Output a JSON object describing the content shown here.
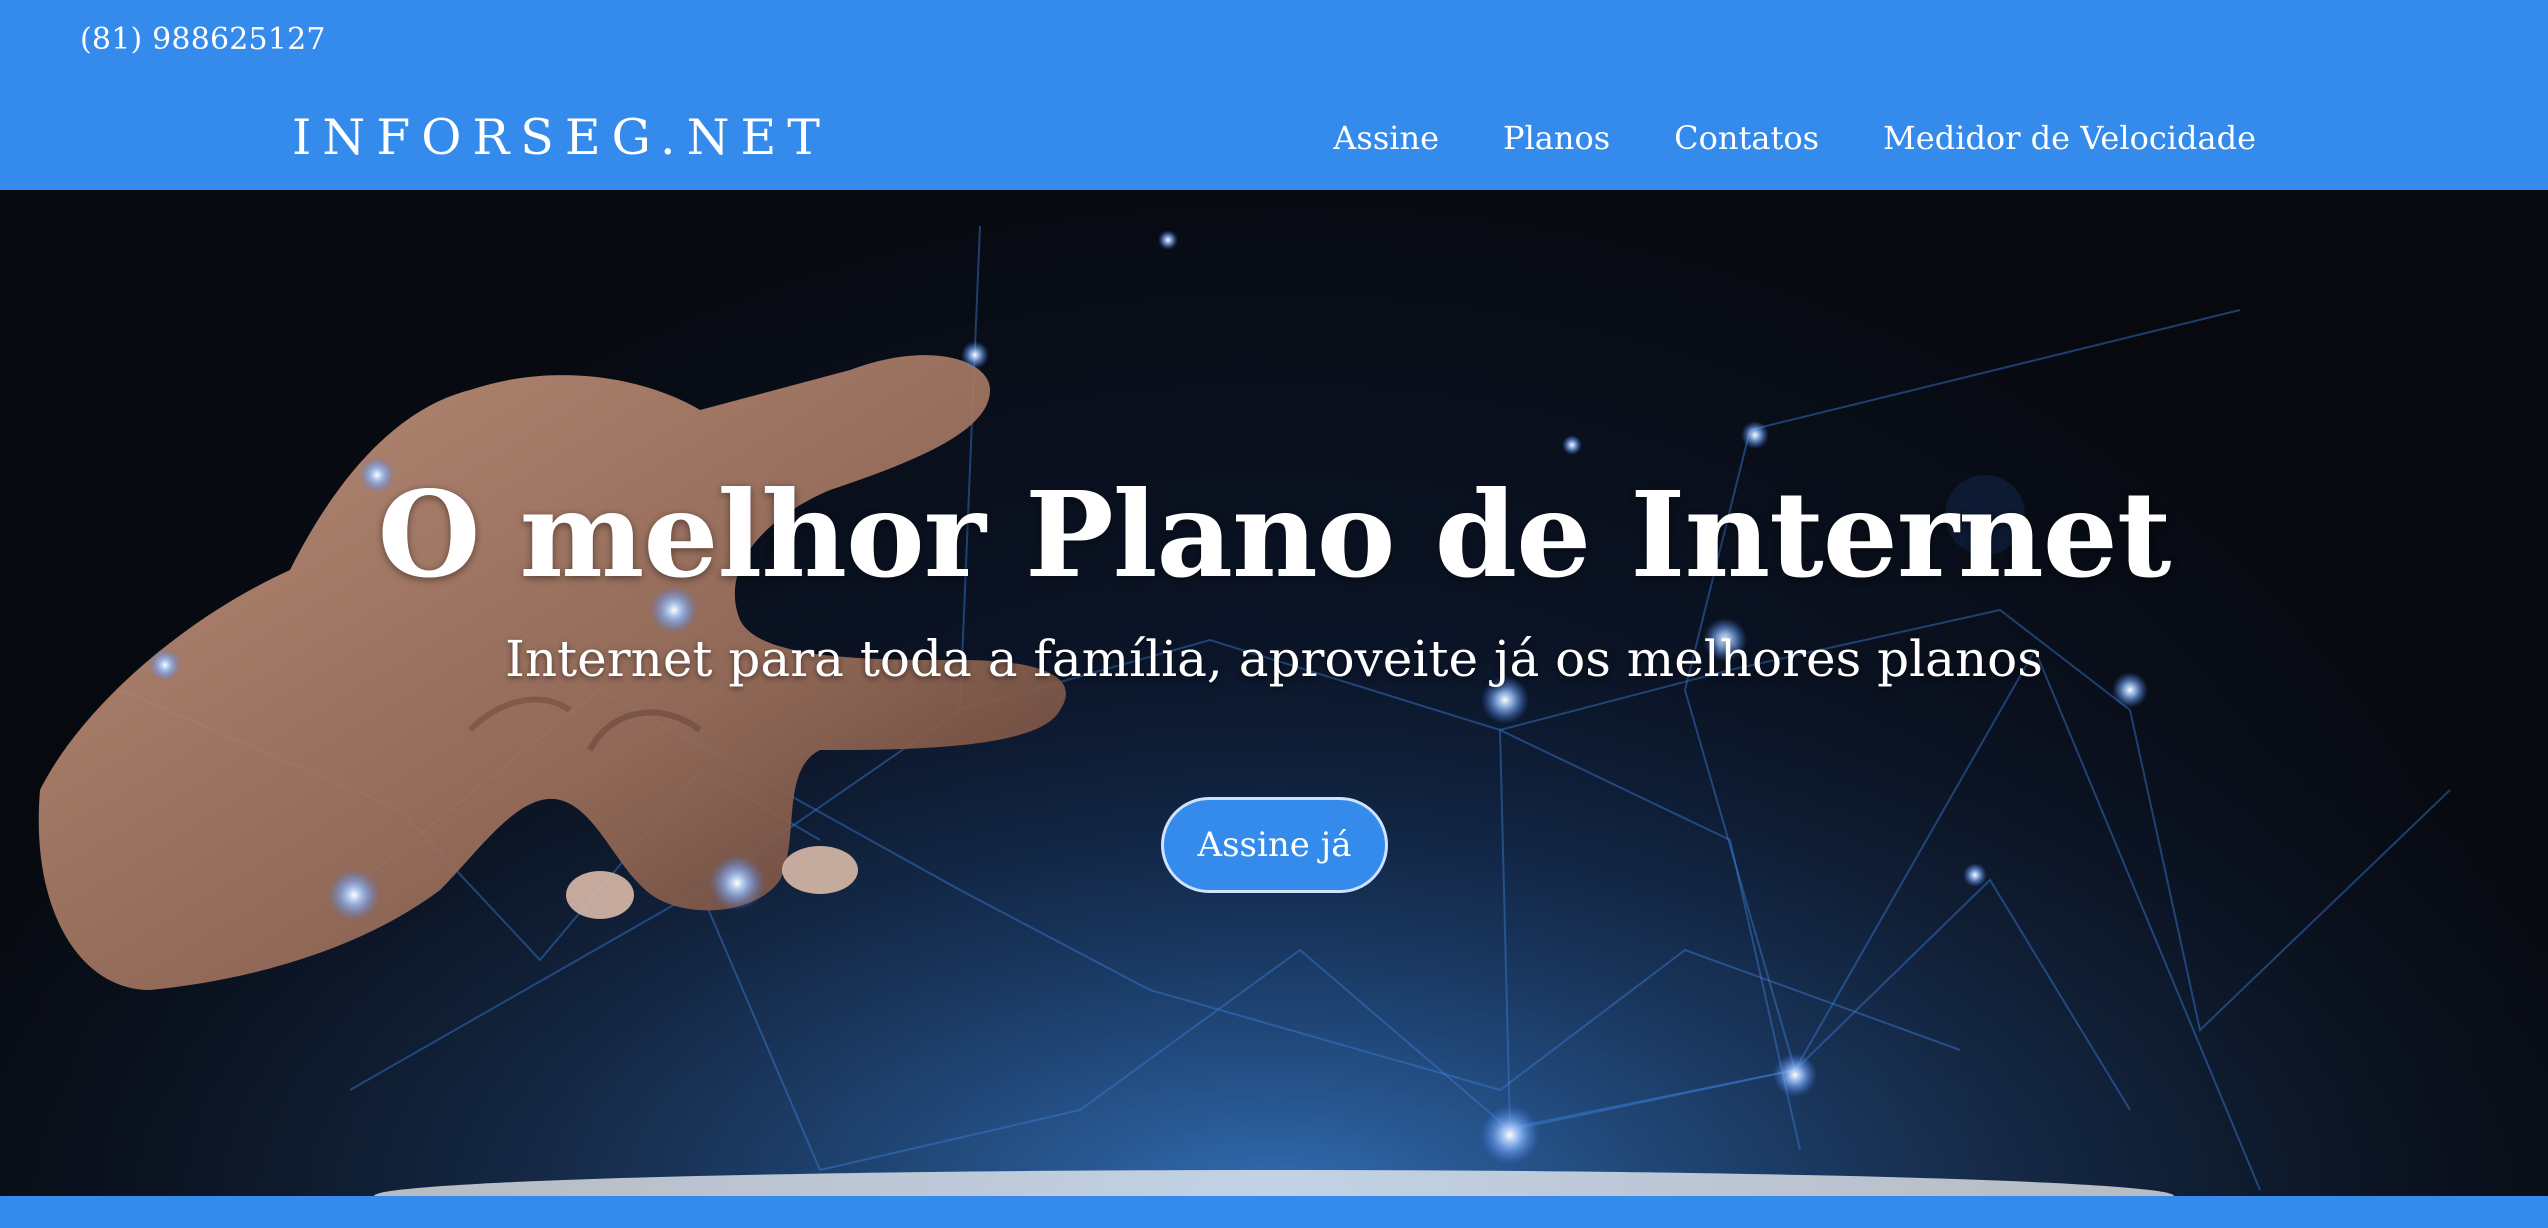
{
  "header": {
    "phone": "(81) 988625127",
    "brand": "INFORSEG.NET",
    "nav": [
      {
        "label": "Assine"
      },
      {
        "label": "Planos"
      },
      {
        "label": "Contatos"
      },
      {
        "label": "Medidor de Velocidade"
      }
    ]
  },
  "hero": {
    "title": "O melhor Plano de Internet",
    "subtitle": "Internet para toda a família, aproveite já os melhores planos",
    "cta_label": "Assine já",
    "background_image": "hand-touching-network-icon"
  },
  "colors": {
    "brand_blue": "#348beb",
    "hero_dark": "#07090f",
    "text": "#ffffff"
  }
}
